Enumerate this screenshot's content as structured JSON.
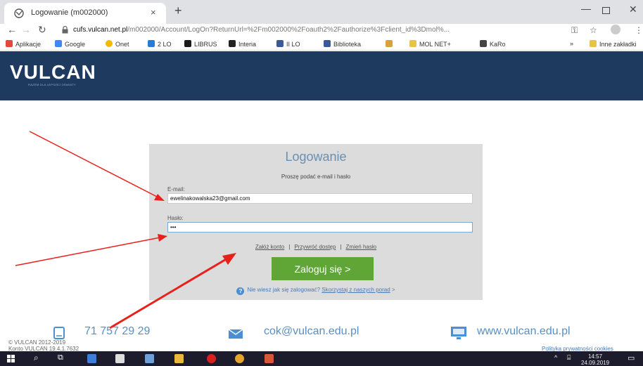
{
  "browser": {
    "tab_title": "Logowanie (m002000)",
    "tab_close": "×",
    "new_tab": "+",
    "url_host": "cufs.vulcan.net.pl",
    "url_path": "/m002000/Account/LogOn?ReturnUrl=%2Fm002000%2Foauth2%2Fauthorize%3Fclient_id%3Dmol%...",
    "window_controls": {
      "minimize": "—",
      "close": "✕"
    },
    "icons": [
      "back-icon",
      "forward-icon",
      "reload-icon",
      "lock-icon",
      "key-icon",
      "star-icon",
      "profile-icon",
      "menu-icon"
    ]
  },
  "bookmarks": {
    "items": [
      {
        "label": "Aplikacje",
        "color": "#e8453c"
      },
      {
        "label": "Google",
        "color": "#4285f4"
      },
      {
        "label": "Onet",
        "color": "#f5b800"
      },
      {
        "label": "2 LO",
        "color": "#2a7bd6"
      },
      {
        "label": "LIBRUS",
        "color": "#1a1a1a"
      },
      {
        "label": "Interia",
        "color": "#222222"
      },
      {
        "label": "II LO",
        "color": "#3b5998"
      },
      {
        "label": "Biblioteka",
        "color": "#3b5998"
      },
      {
        "label": "",
        "color": "#d8a23a"
      },
      {
        "label": "MOL NET+",
        "color": "#e8c34a"
      },
      {
        "label": "KaRo",
        "color": "#444444"
      }
    ],
    "more": "»",
    "other": "Inne zakładki"
  },
  "header": {
    "logo": "VULCAN",
    "logo_tagline": "RAZEM DLA LEPSZEJ OŚWIATY",
    "color": "#1f3a5f"
  },
  "login": {
    "title": "Logowanie",
    "subtitle": "Proszę podać e-mail i hasło",
    "email_label": "E-mail:",
    "email_value": "ewelinakowalska23@gmail.com",
    "password_label": "Hasło:",
    "password_value": "•••",
    "link_create": "Załóż konto",
    "link_restore": "Przywróć dostęp",
    "link_change": "Zmień hasło",
    "separator": "|",
    "submit": "Zaloguj się >",
    "help_prefix": "Nie wiesz jak się zalogować?",
    "help_link": "Skorzystaj z naszych porad",
    "help_suffix": ">",
    "accent": "#5fa637"
  },
  "footer": {
    "phone": "71 757 29 29",
    "email": "cok@vulcan.edu.pl",
    "website": "www.vulcan.edu.pl",
    "copyright": "© VULCAN 2012-2019",
    "version": "Konto VULCAN 19.4.1.7632",
    "privacy": "Polityka prywatności cookies"
  },
  "taskbar": {
    "time": "14:57",
    "date": "24.09.2019"
  }
}
